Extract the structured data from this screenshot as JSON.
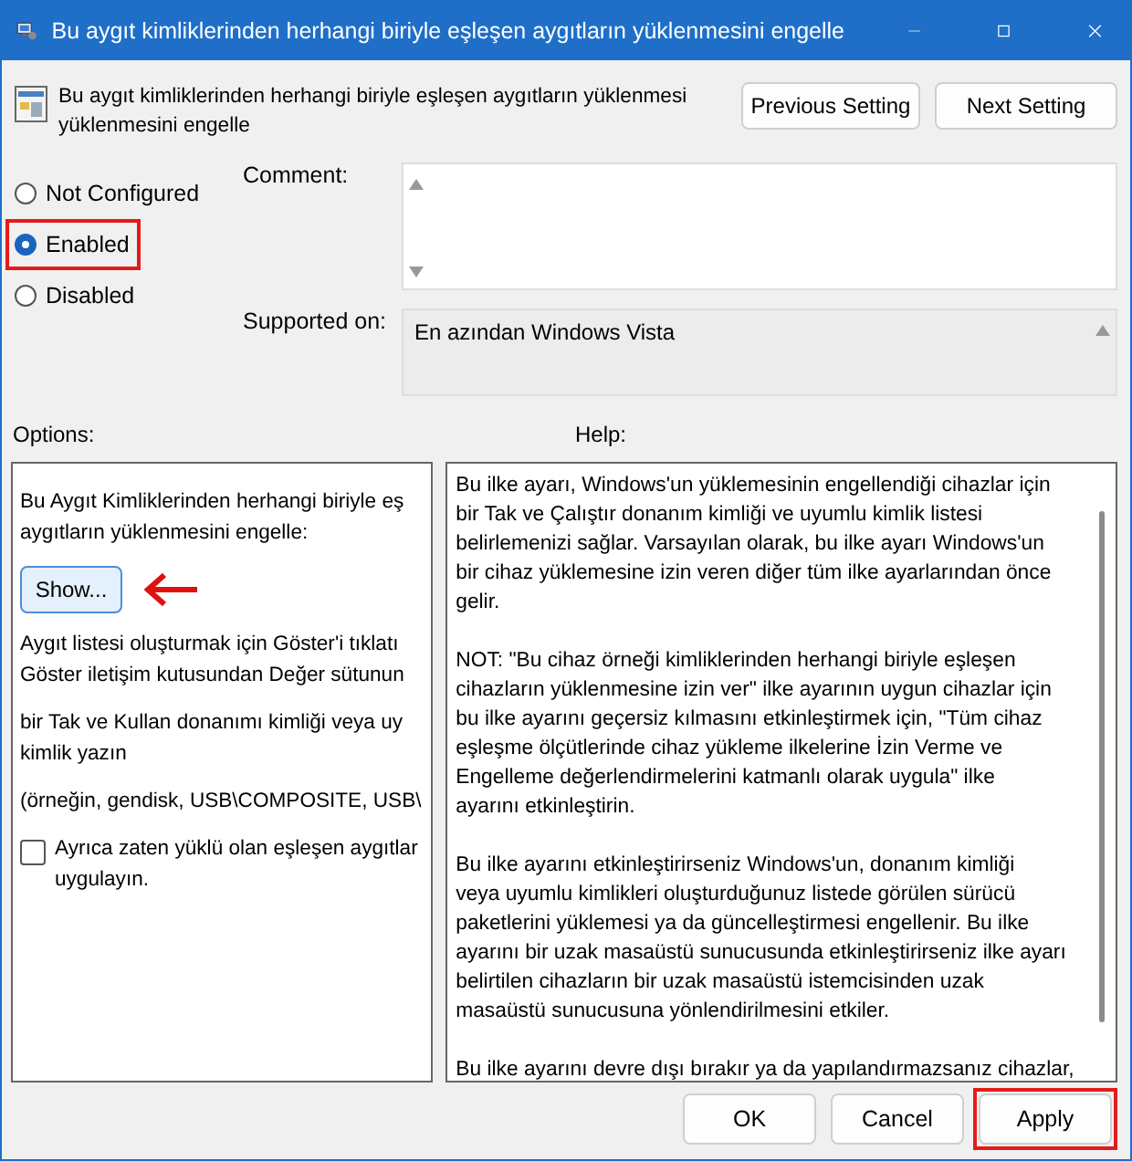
{
  "window": {
    "title": "Bu aygıt kimliklerinden herhangi biriyle eşleşen aygıtların yüklenmesini engelle"
  },
  "header": {
    "lines": [
      "Bu aygıt kimliklerinden herhangi biriyle eşleşen aygıtların yüklenmesi",
      "yüklenmesini  engelle"
    ]
  },
  "nav_buttons": [
    "Previous Setting",
    "Next Setting"
  ],
  "radios": [
    {
      "label": "Not Configured",
      "selected": false,
      "highlighted": false
    },
    {
      "label": "Enabled",
      "selected": true,
      "highlighted": true
    },
    {
      "label": "Disabled",
      "selected": false,
      "highlighted": false
    }
  ],
  "comment": {
    "label": "Comment:"
  },
  "supported": {
    "label": "Supported on:",
    "value": "En azından Windows Vista"
  },
  "options": {
    "label": "Options:",
    "intro": [
      "Bu Aygıt Kimliklerinden herhangi biriyle eş",
      "aygıtların yüklenmesini engelle:"
    ],
    "show_button": "Show...",
    "paragraphs": [
      [
        "Aygıt listesi oluşturmak için Göster'i tıklatı",
        "Göster iletişim kutusundan Değer sütunun"
      ],
      [
        "bir Tak ve Kullan donanımı kimliği veya uy",
        "kimlik yazın"
      ],
      [
        "(örneğin, gendisk, USB\\COMPOSITE, USB\\"
      ]
    ],
    "checkbox": {
      "lines": [
        "Ayrıca zaten yüklü olan eşleşen aygıtlar",
        "uygulayın."
      ],
      "checked": false
    }
  },
  "help": {
    "label": "Help:",
    "paragraphs": [
      [
        "Bu ilke ayarı, Windows'un yüklemesinin engellendiği cihazlar için",
        "bir Tak ve Çalıştır donanım kimliği ve uyumlu kimlik listesi",
        "belirlemenizi sağlar. Varsayılan olarak, bu ilke ayarı Windows'un",
        "bir cihaz yüklemesine izin veren diğer tüm ilke ayarlarından önce",
        "gelir."
      ],
      [
        "NOT: \"Bu cihaz örneği kimliklerinden herhangi biriyle eşleşen",
        "cihazların yüklenmesine izin ver\" ilke ayarının uygun cihazlar için",
        "bu ilke ayarını geçersiz kılmasını etkinleştirmek için, \"Tüm cihaz",
        "eşleşme ölçütlerinde cihaz yükleme ilkelerine İzin Verme ve",
        "Engelleme değerlendirmelerini katmanlı olarak uygula\" ilke",
        "ayarını etkinleştirin."
      ],
      [
        "Bu ilke ayarını etkinleştirirseniz Windows'un, donanım kimliği",
        "veya uyumlu kimlikleri oluşturduğunuz listede görülen sürücü",
        "paketlerini yüklemesi ya da güncelleştirmesi engellenir. Bu ilke",
        "ayarını bir uzak masaüstü sunucusunda etkinleştirirseniz ilke ayarı",
        "belirtilen cihazların bir uzak masaüstü istemcisinden uzak",
        "masaüstü sunucusuna yönlendirilmesini etkiler."
      ],
      [
        "Bu ilke ayarını devre dışı bırakır ya da yapılandırmazsanız cihazlar,"
      ]
    ]
  },
  "footer_buttons": [
    {
      "label": "OK",
      "highlighted": false
    },
    {
      "label": "Cancel",
      "highlighted": false
    },
    {
      "label": "Apply",
      "highlighted": true
    }
  ]
}
